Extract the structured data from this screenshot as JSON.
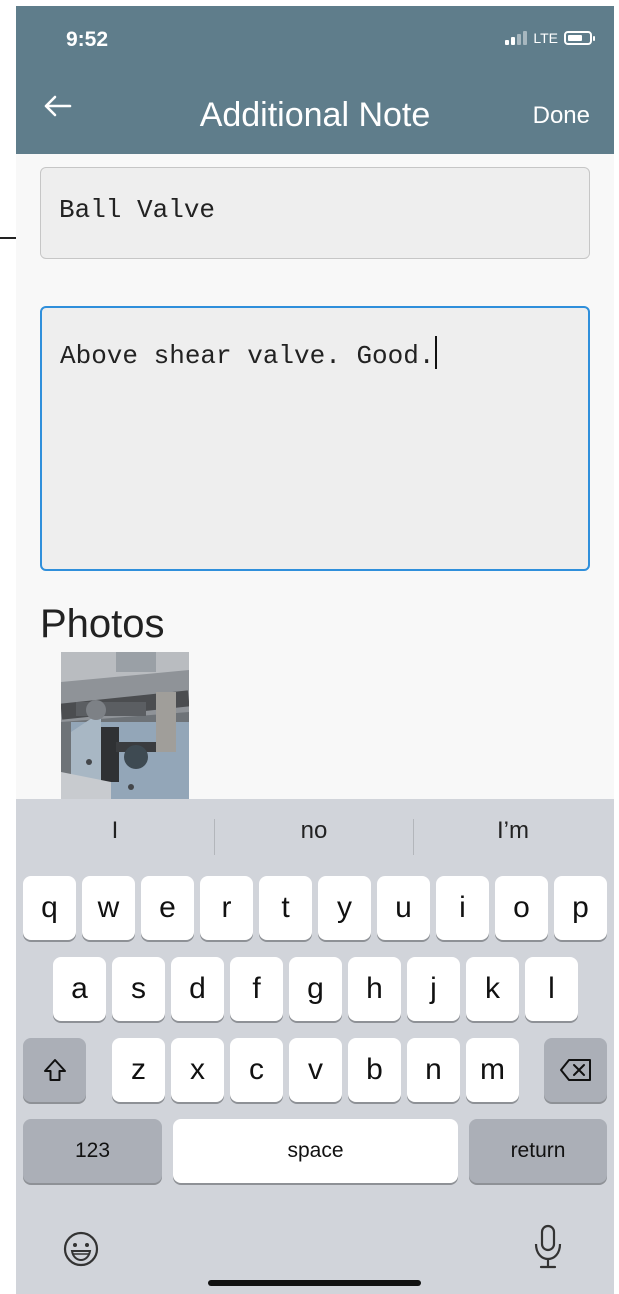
{
  "status_bar": {
    "time": "9:52",
    "network": "LTE"
  },
  "nav": {
    "title": "Additional Note",
    "done_label": "Done",
    "back_icon": "arrow-left-icon"
  },
  "form": {
    "title_value": "Ball Valve",
    "note_value": "Above shear valve. Good."
  },
  "photos": {
    "heading": "Photos",
    "count": 1
  },
  "keyboard": {
    "suggestions": [
      "I",
      "no",
      "I’m"
    ],
    "row1": [
      "q",
      "w",
      "e",
      "r",
      "t",
      "y",
      "u",
      "i",
      "o",
      "p"
    ],
    "row2": [
      "a",
      "s",
      "d",
      "f",
      "g",
      "h",
      "j",
      "k",
      "l"
    ],
    "row3": [
      "z",
      "x",
      "c",
      "v",
      "b",
      "n",
      "m"
    ],
    "numbers_label": "123",
    "space_label": "space",
    "return_label": "return",
    "icons": [
      "shift-icon",
      "backspace-icon",
      "emoji-icon",
      "microphone-icon"
    ]
  },
  "colors": {
    "header": "#5f7d8b",
    "focus": "#2f8fdb",
    "keyboard": "#d1d4da"
  }
}
